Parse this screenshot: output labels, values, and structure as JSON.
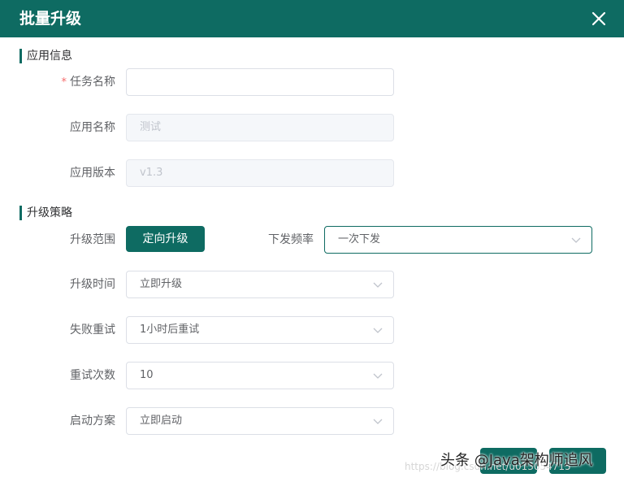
{
  "dialog": {
    "title": "批量升级"
  },
  "sections": {
    "app_info": "应用信息",
    "upgrade_strategy": "升级策略"
  },
  "form": {
    "required_mark": "*",
    "task_name": {
      "label": "任务名称",
      "value": ""
    },
    "app_name": {
      "label": "应用名称",
      "value": "测试"
    },
    "app_version": {
      "label": "应用版本",
      "value": "v1.3"
    },
    "upgrade_scope": {
      "label": "升级范围",
      "button": "定向升级"
    },
    "dispatch_freq": {
      "label": "下发频率",
      "value": "一次下发"
    },
    "upgrade_time": {
      "label": "升级时间",
      "value": "立即升级"
    },
    "fail_retry": {
      "label": "失败重试",
      "value": "1小时后重试"
    },
    "retry_count": {
      "label": "重试次数",
      "value": "10"
    },
    "start_plan": {
      "label": "启动方案",
      "value": "立即启动"
    }
  },
  "footer": {
    "watermark": "头条 @Java架构师追风",
    "watermark_url": "https://blog.csdn.net/u013054715"
  },
  "colors": {
    "primary": "#0e6b62",
    "required": "#f56c6c"
  }
}
